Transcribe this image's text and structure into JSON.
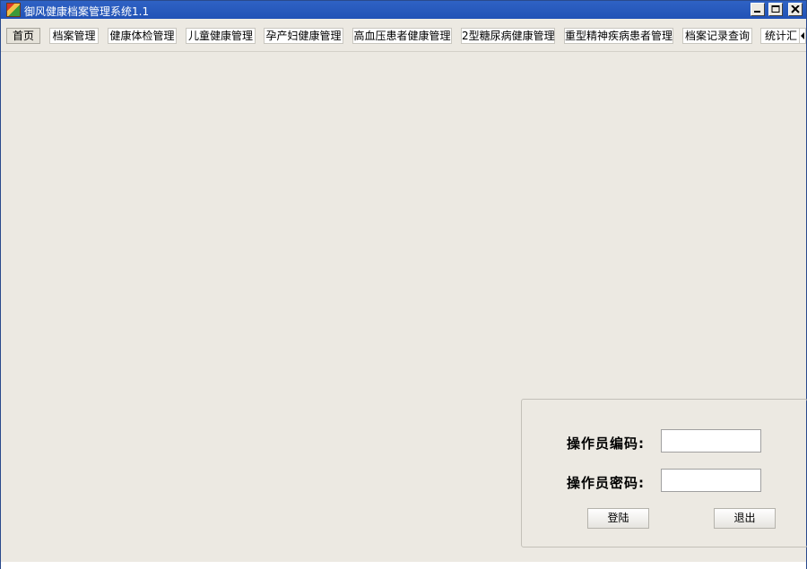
{
  "window": {
    "title": "御风健康档案管理系统1.1"
  },
  "menu": {
    "tabs": [
      {
        "label": "首页"
      },
      {
        "label": "档案管理"
      },
      {
        "label": "健康体检管理"
      },
      {
        "label": "儿童健康管理"
      },
      {
        "label": "孕产妇健康管理"
      },
      {
        "label": "高血压患者健康管理"
      },
      {
        "label": "2型糖尿病健康管理"
      },
      {
        "label": "重型精神疾病患者管理"
      },
      {
        "label": "档案记录查询"
      },
      {
        "label": "统计汇"
      }
    ]
  },
  "login": {
    "operator_id_label": "操作员编码:",
    "operator_id_value": "",
    "password_label": "操作员密码:",
    "password_value": "",
    "login_button": "登陆",
    "exit_button": "退出"
  }
}
